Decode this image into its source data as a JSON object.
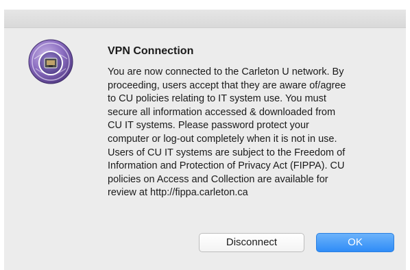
{
  "dialog": {
    "title": "VPN Connection",
    "message": "You are now connected to the Carleton U network. By proceeding, users accept that they are aware of/agree to CU policies relating to IT system use. You must secure all information accessed & downloaded from CU IT systems. Please password protect your computer or log-out completely when it is not in use. Users of CU IT systems are subject to the Freedom of Information and Protection of Privacy Act (FIPPA). CU policies on Access and Collection are available for review at http://fippa.carleton.ca",
    "message_lines": [
      "You are now connected to the Carleton U network. By",
      "proceeding, users accept that they are aware of/agree",
      "to CU policies relating to IT system use. You must",
      "secure all information accessed & downloaded from",
      "CU IT systems. Please password protect your",
      "computer or log-out completely when it is not in use.",
      "Users of CU IT systems are subject to the Freedom of",
      "Information and Protection of Privacy Act (FIPPA). CU",
      "policies on Access and Collection are available for",
      "review at http://fippa.carleton.ca"
    ],
    "icon": "vpn-network-port-icon",
    "buttons": {
      "disconnect_label": "Disconnect",
      "ok_label": "OK"
    }
  },
  "colors": {
    "dialog_background": "#ececec",
    "primary_button": "#2f8cf7",
    "icon_purple": "#7b5fae"
  }
}
